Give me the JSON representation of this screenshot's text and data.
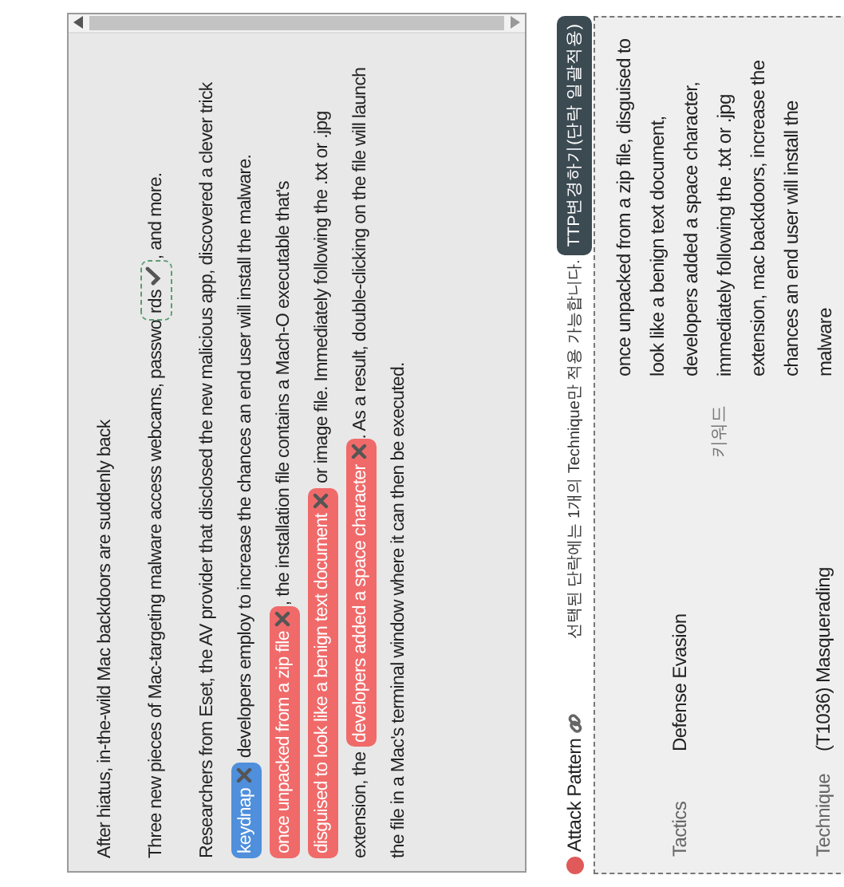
{
  "article": {
    "title": "After hiatus, in-the-wild Mac backdoors are suddenly back",
    "paragraphs": [
      [
        {
          "kind": "text",
          "text": "Three new pieces of Mac-targeting malware access webcams, passwo"
        },
        {
          "kind": "suggestion",
          "text": "rds"
        },
        {
          "kind": "text",
          "text": ", and more."
        }
      ],
      [
        {
          "kind": "text",
          "text": "Researchers from Eset, the AV provider that disclosed the new malicious app, discovered a clever trick "
        },
        {
          "kind": "tag",
          "text": "keydnap",
          "color": "#4f8fdb"
        },
        {
          "kind": "text",
          "text": " developers employ to increase the chances an end user will install the malware. "
        },
        {
          "kind": "tag",
          "text": "once unpacked from a zip file",
          "color": "#f06a6a"
        },
        {
          "kind": "text",
          "text": ", the installation file contains a Mach-O executable that's "
        },
        {
          "kind": "tag",
          "text": "disguised to look like a benign text document",
          "color": "#f06a6a"
        },
        {
          "kind": "text",
          "text": " or image file. Immediately following the .txt or .jpg extension, the "
        },
        {
          "kind": "tag",
          "text": "developers added a space character",
          "color": "#f06a6a"
        },
        {
          "kind": "text",
          "text": ". As a result, double-clicking on the file will launch the file in a Mac's terminal window where it can then be executed."
        }
      ]
    ]
  },
  "attack_pattern": {
    "title": "Attack Pattern",
    "note": "선택된 단락에는 1개의 Technique만 적용 가능합니다.",
    "button": "TTP변경하기(단락 일괄적용)",
    "fields": [
      {
        "label": "Tactics",
        "value": "Defense Evasion"
      },
      {
        "label": "Technique",
        "value": "(T1036) Masquerading"
      }
    ],
    "keyword": {
      "label": "키워드",
      "value": "once unpacked from a zip file, disguised to look like a benign text document, developers added a space character, immediately following the .txt or .jpg extension, mac backdoors, increase the chances an end user will install the malware"
    }
  }
}
